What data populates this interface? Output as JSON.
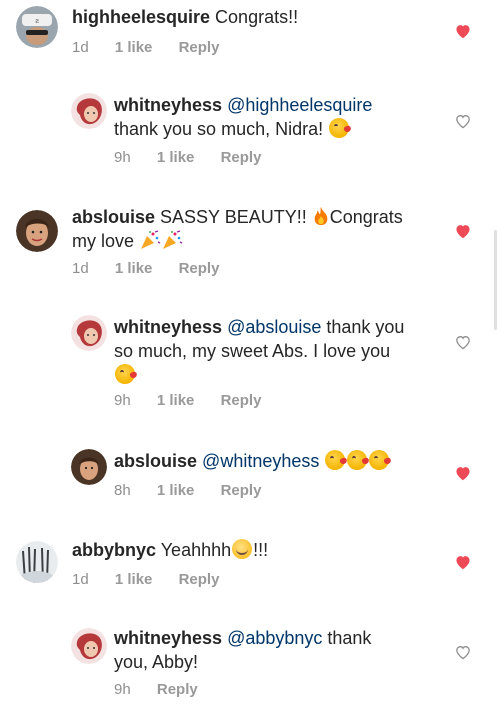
{
  "comments": [
    {
      "username": "highheelesquire",
      "text": " Congrats!!",
      "time": "1d",
      "likes": "1 like",
      "reply": "Reply",
      "heart": "filled"
    },
    {
      "username": "whitneyhess",
      "mention": "@highheelesquire",
      "text_line2": "thank you so much, Nidra!",
      "time": "9h",
      "likes": "1 like",
      "reply": "Reply",
      "heart": "outline"
    },
    {
      "username": "abslouise",
      "text": " SASSY BEAUTY!! ",
      "text2": "Congrats",
      "text_line2": "my love ",
      "time": "1d",
      "likes": "1 like",
      "reply": "Reply",
      "heart": "filled"
    },
    {
      "username": "whitneyhess",
      "mention": "@abslouise",
      "text": " thank you",
      "text_line2": "so much, my sweet Abs. I love you",
      "time": "9h",
      "likes": "1 like",
      "reply": "Reply",
      "heart": "outline"
    },
    {
      "username": "abslouise",
      "mention": "@whitneyhess",
      "time": "8h",
      "likes": "1 like",
      "reply": "Reply",
      "heart": "filled"
    },
    {
      "username": "abbybnyc",
      "text": " Yeahhhh",
      "text2": "!!!",
      "time": "1d",
      "likes": "1 like",
      "reply": "Reply",
      "heart": "filled"
    },
    {
      "username": "whitneyhess",
      "mention": "@abbybnyc",
      "text": " thank",
      "text_line2": "you, Abby!",
      "time": "9h",
      "reply": "Reply",
      "heart": "outline"
    }
  ],
  "colors": {
    "heart_filled": "#ed4956",
    "heart_outline": "#8e8e8e",
    "mention": "#003569",
    "meta": "#8e8e8e"
  },
  "icons": {
    "heart_filled": "heart-filled-icon",
    "heart_outline": "heart-outline-icon"
  }
}
